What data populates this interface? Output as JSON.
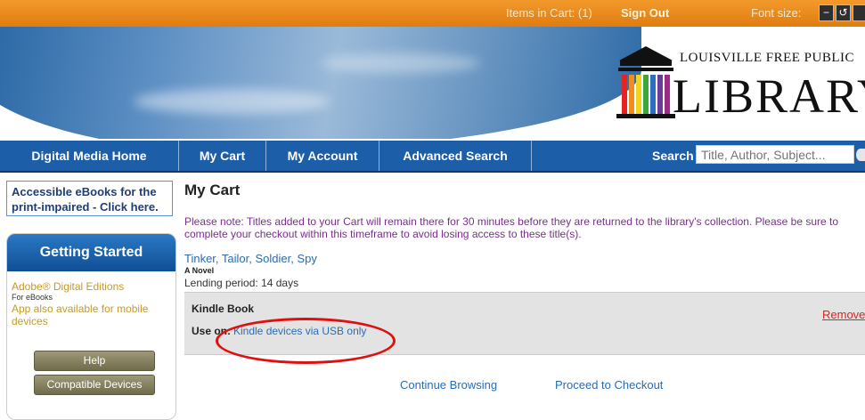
{
  "topbar": {
    "items_in_cart": "Items in Cart: (1)",
    "sign_out": "Sign Out",
    "font_size": "Font size:",
    "font_buttons": [
      "−",
      "↺",
      ""
    ]
  },
  "logo": {
    "line1": "LOUISVILLE FREE PUBLIC",
    "line2": "LIBRARY"
  },
  "nav": {
    "items": [
      "Digital Media Home",
      "My Cart",
      "My Account",
      "Advanced Search"
    ],
    "search_label": "Search",
    "search_placeholder": "Title, Author, Subject..."
  },
  "sidebar": {
    "accessible": "Accessible eBooks for the print-impaired - Click here.",
    "getting_started": "Getting Started",
    "ade": "Adobe® Digital Editions",
    "ade_sub": "For eBooks",
    "ade_note": "App also available for mobile devices",
    "help": "Help",
    "compatible": "Compatible Devices"
  },
  "main": {
    "heading": "My Cart",
    "note": "Please note: Titles added to your Cart will remain there for 30 minutes before they are returned to the library's collection. Please be sure to complete your checkout within this timeframe to avoid losing access to these title(s).",
    "title": "Tinker, Tailor, Soldier, Spy",
    "subtitle": "A Novel",
    "lending": "Lending period: 14 days",
    "format": "Kindle Book",
    "use_on": "Use on:",
    "use_on_value": "Kindle devices via USB only",
    "remove": "Remove",
    "continue": "Continue Browsing",
    "proceed": "Proceed to Checkout"
  },
  "colors": {
    "topbar": "#e8871a",
    "nav": "#1d5ea8",
    "link": "#2c6cb0",
    "annotation_circle": "#e01010"
  }
}
